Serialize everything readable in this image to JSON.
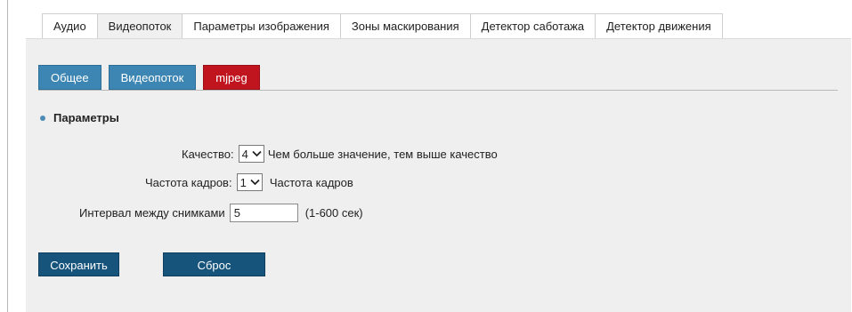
{
  "top_tabs": [
    {
      "label": "Аудио",
      "active": false
    },
    {
      "label": "Видеопоток",
      "active": true
    },
    {
      "label": "Параметры изображения",
      "active": false
    },
    {
      "label": "Зоны маскирования",
      "active": false
    },
    {
      "label": "Детектор саботажа",
      "active": false
    },
    {
      "label": "Детектор движения",
      "active": false
    }
  ],
  "sub_tabs": [
    {
      "label": "Общее",
      "active": false
    },
    {
      "label": "Видеопоток",
      "active": false
    },
    {
      "label": "mjpeg",
      "active": true
    }
  ],
  "section": {
    "title": "Параметры"
  },
  "form": {
    "quality": {
      "label": "Качество:",
      "value": "4",
      "hint": "Чем больше значение, тем выше качество"
    },
    "framerate": {
      "label": "Частота кадров:",
      "value": "1",
      "hint": "Частота кадров"
    },
    "interval": {
      "label": "Интервал между снимками",
      "value": "5",
      "hint": "(1-600 сек)"
    }
  },
  "buttons": {
    "save": "Сохранить",
    "reset": "Сброс"
  },
  "colors": {
    "subtab": "#3d86b4",
    "subtab_active": "#c0141e",
    "button": "#16547c"
  }
}
